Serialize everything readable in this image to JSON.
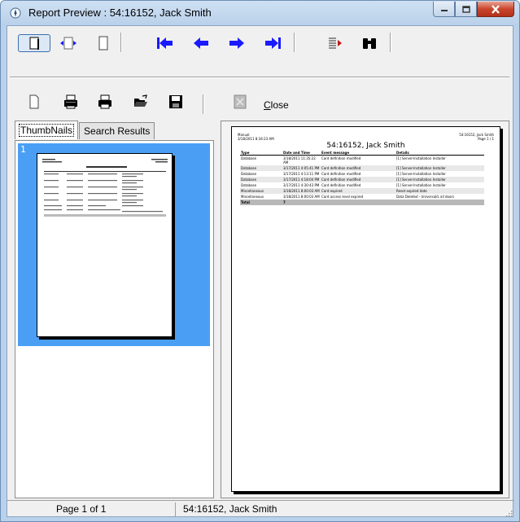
{
  "window": {
    "title": "Report Preview : 54:16152, Jack Smith"
  },
  "toolbar": {
    "close_label": "Close",
    "close_mnemonic": "C",
    "close_rest": "lose"
  },
  "tabs": [
    {
      "label": "ThumbNails"
    },
    {
      "label": "Search Results"
    }
  ],
  "thumbnail": {
    "number": "1"
  },
  "report": {
    "header_left_1": "Manual",
    "header_left_2": "3/18/2011 8:34:23 AM",
    "header_right_1": "54:16152, Jack Smith",
    "header_right_2": "Page 1 / 1",
    "title": "54:16152, Jack Smith",
    "columns": [
      "Type",
      "Date and Time",
      "Event message",
      "Details"
    ],
    "rows": [
      [
        "Database",
        "3/18/2011 11:35:22 AM",
        "Card definition modified",
        "[1] Server-Installation Installer"
      ],
      [
        "Database",
        "3/17/2011 4:05:41 PM",
        "Card definition modified",
        "[1] Server-Installation Installer"
      ],
      [
        "Database",
        "3/17/2011 4:13:11 PM",
        "Card definition modified",
        "[1] Server-Installation Installer"
      ],
      [
        "Database",
        "3/17/2011 4:18:04 PM",
        "Card definition modified",
        "[1] Server-Installation Installer"
      ],
      [
        "Database",
        "3/17/2011 4:30:43 PM",
        "Card definition modified",
        "[1] Server-Installation Installer"
      ],
      [
        "Miscellaneous",
        "3/18/2011 8:00:03 AM",
        "Card expired",
        "Reset expired date"
      ],
      [
        "Miscellaneous",
        "3/18/2011 8:00:03 AM",
        "Card access level expired",
        "Data Deleted - Universal/L all doors"
      ]
    ],
    "total_label": "Total",
    "total_value": "7"
  },
  "status": {
    "page": "Page 1 of 1",
    "report": "54:16152, Jack Smith"
  },
  "colors": {
    "arrow": "#1a1aff",
    "selection": "#4a9ff5"
  }
}
